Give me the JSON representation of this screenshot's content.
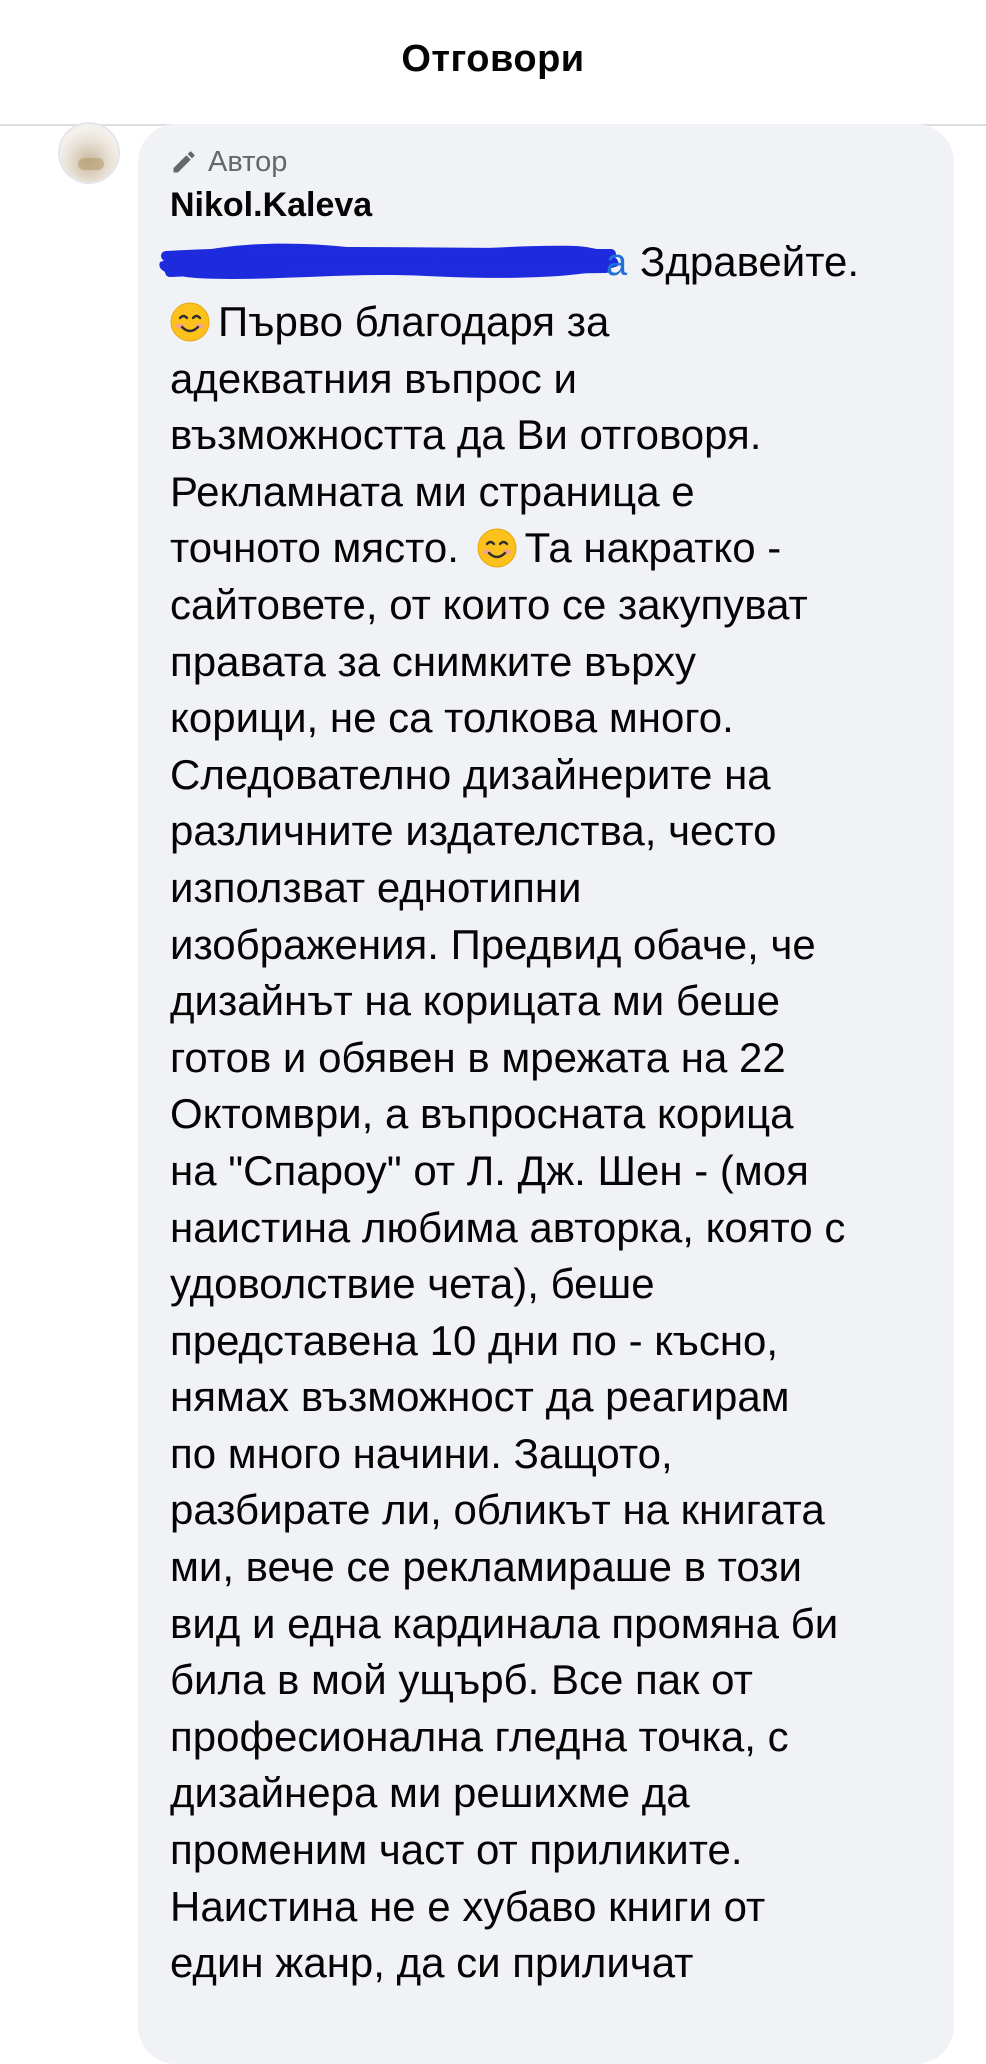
{
  "header": {
    "title": "Отговори"
  },
  "comment": {
    "badge_label": "Автор",
    "badge_icon": "pencil-icon",
    "author": "Nikol.Kaleva",
    "mention_visible_tail": "a",
    "first_word": "Здравейте.",
    "lines": [
      "Първо благодаря за",
      "адекватния въпрос и",
      "възможността да Ви отговоря.",
      "Рекламната ми страница е",
      "точното място.",
      "Та накратко -",
      "сайтовете, от които се закупуват",
      "правата за снимките върху",
      "корици, не са толкова много.",
      "Следователно дизайнерите на",
      "различните издателства, често",
      "използват еднотипни",
      "изображения. Предвид обаче, че",
      "дизайнът на корицата ми беше",
      "готов и обявен в мрежата на 22",
      "Октомври, а въпросната корица",
      "на \"Спароу\" от Л. Дж. Шен - (моя",
      "наистина любима авторка, която с",
      "удоволствие чета), беше",
      "представена 10 дни по - късно,",
      "нямах възможност да реагирам",
      "по много начини. Защото,",
      "разбирате ли, обликът на книгата",
      "ми, вече се рекламираше в този",
      "вид и една кардинала промяна би",
      "била в мой ущърб. Все пак от",
      "професионална гледна точка, с",
      "дизайнера ми решихме да",
      "променим част от приликите.",
      "Наистина не е хубаво книги от",
      "един жанр, да си приличат"
    ]
  },
  "colors": {
    "bubble": "#f0f2f5",
    "mention": "#216fdb",
    "redaction": "#1d2bdc",
    "secondary_text": "#65676b"
  }
}
